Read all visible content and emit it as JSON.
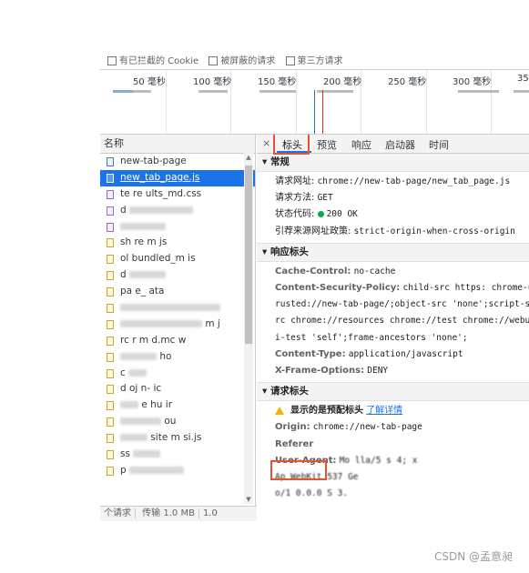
{
  "filter_row": {
    "items": [
      "有已拦截的 Cookie",
      "被屏蔽的请求",
      "第三方请求"
    ]
  },
  "timeline": {
    "ticks": [
      "50 毫秒",
      "100 毫秒",
      "150 毫秒",
      "200 毫秒",
      "250 毫秒",
      "300 毫秒",
      "35"
    ]
  },
  "left_panel": {
    "name_header": "名称",
    "requests": [
      {
        "name": "new-tab-page",
        "type": "doc"
      },
      {
        "name": "new_tab_page.js",
        "type": "js",
        "selected": true
      },
      {
        "name": "te  re  ults_md.css",
        "type": "css"
      },
      {
        "name": "d",
        "type": "img"
      },
      {
        "name": "",
        "type": "img"
      },
      {
        "name": "sh  re  m  js",
        "type": "js"
      },
      {
        "name": "  ol  bundled_m  is",
        "type": "js"
      },
      {
        "name": "d",
        "type": "js"
      },
      {
        "name": "pa  e_  ata",
        "type": "js"
      },
      {
        "name": "",
        "type": "js"
      },
      {
        "name": "  m  j",
        "type": "js"
      },
      {
        "name": "  rc  r  m  d.mc  w",
        "type": "js"
      },
      {
        "name": "  ho",
        "type": "js"
      },
      {
        "name": "c",
        "type": "js"
      },
      {
        "name": "d  oj  n-  ic",
        "type": "js"
      },
      {
        "name": "  e  hu  ir",
        "type": "js"
      },
      {
        "name": "  ou",
        "type": "js"
      },
      {
        "name": "  site  m  si.js",
        "type": "js"
      },
      {
        "name": "  ss",
        "type": "js"
      },
      {
        "name": "p",
        "type": "js"
      }
    ],
    "status": [
      "  个请求",
      "  传输 1.0 MB",
      "1.0"
    ]
  },
  "right_panel": {
    "close_label": "×",
    "tabs": [
      "标头",
      "预览",
      "响应",
      "启动器",
      "时间"
    ],
    "general": {
      "title": "常规",
      "rows": [
        {
          "key": "请求网址:",
          "value": "chrome://new-tab-page/new_tab_page.js"
        },
        {
          "key": "请求方法:",
          "value": "GET"
        },
        {
          "key": "状态代码:",
          "value": "200 OK"
        },
        {
          "key": "引荐来源网址政策:",
          "value": "strict-origin-when-cross-origin"
        }
      ]
    },
    "response_headers": {
      "title": "响应标头",
      "rows": [
        {
          "key": "Cache-Control:",
          "value": "no-cache"
        },
        {
          "key": "Content-Security-Policy:",
          "value": "child-src https:  chrome-unt"
        },
        {
          "key": "",
          "value": "rusted://new-tab-page/;object-src 'none';script-s"
        },
        {
          "key": "",
          "value": "rc chrome://resources chrome://test chrome://webu"
        },
        {
          "key": "",
          "value": "i-test 'self';frame-ancestors 'none';"
        },
        {
          "key": "Content-Type:",
          "value": "application/javascript"
        },
        {
          "key": "X-Frame-Options:",
          "value": "DENY"
        }
      ]
    },
    "request_headers": {
      "title": "请求标头",
      "warning": "显示的是预配标头",
      "learn_more": "了解详情",
      "rows": [
        {
          "key": "Origin:",
          "value": "chrome://new-tab-page"
        },
        {
          "key": "Referer",
          "value": ""
        },
        {
          "key": "User-Agent:",
          "value": "Mo  lla/5  s  4; x"
        },
        {
          "key": "",
          "value": "  Ap  WebKit 537  Ge"
        },
        {
          "key": "",
          "value": "o/1  0.0.0  S  3."
        }
      ]
    }
  },
  "watermark": "CSDN @孟意昶",
  "colors": {
    "accent": "#1a73e8",
    "highlight_box": "#e8532d",
    "status_ok": "#0aa84f",
    "warning": "#f2b600"
  }
}
